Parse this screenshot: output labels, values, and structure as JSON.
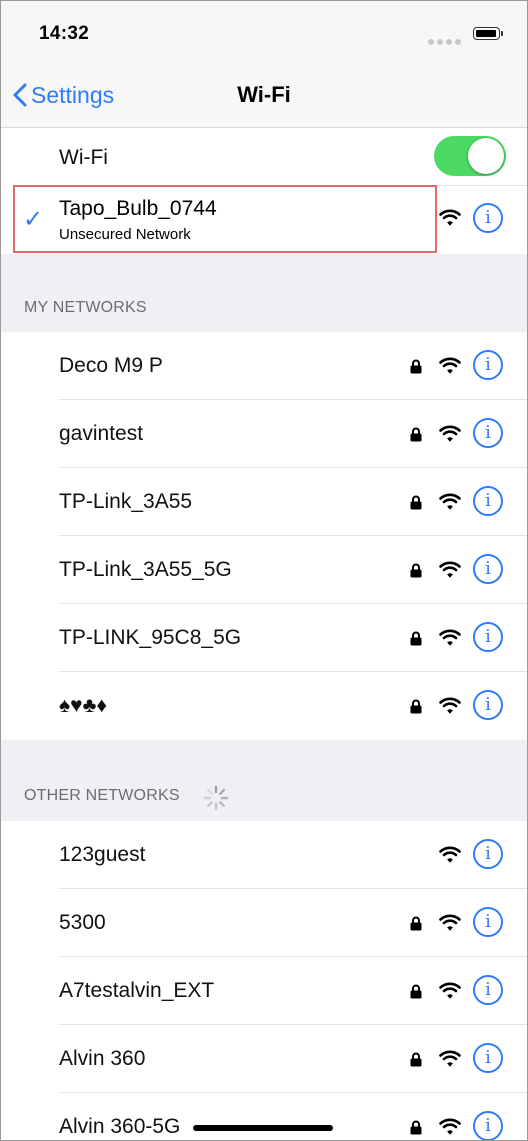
{
  "status_bar": {
    "time": "14:32"
  },
  "nav": {
    "back_label": "Settings",
    "title": "Wi-Fi"
  },
  "wifi_toggle": {
    "label": "Wi-Fi",
    "on": true
  },
  "connected": {
    "name": "Tapo_Bulb_0744",
    "subtitle": "Unsecured Network",
    "checkmark": "✓"
  },
  "my_networks": {
    "header": "MY NETWORKS",
    "items": [
      {
        "name": "Deco M9 P",
        "locked": true
      },
      {
        "name": "gavintest",
        "locked": true
      },
      {
        "name": "TP-Link_3A55",
        "locked": true
      },
      {
        "name": "TP-Link_3A55_5G",
        "locked": true
      },
      {
        "name": "TP-LINK_95C8_5G",
        "locked": true
      },
      {
        "name": "♠♥♣♦",
        "locked": true
      }
    ]
  },
  "other_networks": {
    "header": "OTHER NETWORKS",
    "items": [
      {
        "name": "123guest",
        "locked": false
      },
      {
        "name": "5300",
        "locked": true
      },
      {
        "name": "A7testalvin_EXT",
        "locked": true
      },
      {
        "name": "Alvin 360",
        "locked": true
      },
      {
        "name": "Alvin 360-5G",
        "locked": true
      }
    ]
  },
  "icons": {
    "info": "info-icon",
    "lock": "lock-icon",
    "wifi": "wifi-icon",
    "back": "chevron-left-icon",
    "spinner": "loading-spinner-icon"
  },
  "colors": {
    "accent": "#2f7cf6",
    "toggle_on": "#4cd964",
    "highlight": "#e36b6b"
  }
}
